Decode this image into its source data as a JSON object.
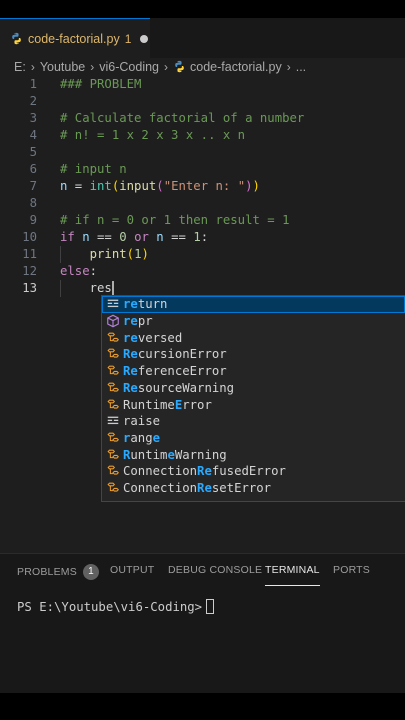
{
  "tab": {
    "filename": "code-factorial.py",
    "problem_count": "1",
    "icon": "python-icon"
  },
  "breadcrumb": {
    "drive": "E:",
    "folder1": "Youtube",
    "folder2": "vi6-Coding",
    "file": "code-factorial.py",
    "more": "..."
  },
  "editor": {
    "lines": [
      {
        "n": "1",
        "tokens": [
          {
            "t": "### PROBLEM",
            "c": "c-comment"
          }
        ]
      },
      {
        "n": "2",
        "tokens": []
      },
      {
        "n": "3",
        "tokens": [
          {
            "t": "# Calculate factorial of a number",
            "c": "c-comment"
          }
        ]
      },
      {
        "n": "4",
        "tokens": [
          {
            "t": "# n! = 1 x 2 x 3 x .. x n",
            "c": "c-comment"
          }
        ]
      },
      {
        "n": "5",
        "tokens": []
      },
      {
        "n": "6",
        "tokens": [
          {
            "t": "# input n",
            "c": "c-comment"
          }
        ]
      },
      {
        "n": "7",
        "tokens": [
          {
            "t": "n",
            "c": "c-var"
          },
          {
            "t": " = ",
            "c": "c-op"
          },
          {
            "t": "int",
            "c": "c-cls"
          },
          {
            "t": "(",
            "c": "c-paren"
          },
          {
            "t": "input",
            "c": "c-fn"
          },
          {
            "t": "(",
            "c": "c-paren2"
          },
          {
            "t": "\"Enter n: \"",
            "c": "c-str"
          },
          {
            "t": ")",
            "c": "c-paren2"
          },
          {
            "t": ")",
            "c": "c-paren"
          }
        ]
      },
      {
        "n": "8",
        "tokens": []
      },
      {
        "n": "9",
        "tokens": [
          {
            "t": "# if n = 0 or 1 then result = 1",
            "c": "c-comment"
          }
        ]
      },
      {
        "n": "10",
        "tokens": [
          {
            "t": "if",
            "c": "c-kw"
          },
          {
            "t": " ",
            "c": "c-op"
          },
          {
            "t": "n",
            "c": "c-var"
          },
          {
            "t": " == ",
            "c": "c-op"
          },
          {
            "t": "0",
            "c": "c-num"
          },
          {
            "t": " ",
            "c": "c-op"
          },
          {
            "t": "or",
            "c": "c-kw"
          },
          {
            "t": " ",
            "c": "c-op"
          },
          {
            "t": "n",
            "c": "c-var"
          },
          {
            "t": " == ",
            "c": "c-op"
          },
          {
            "t": "1",
            "c": "c-num"
          },
          {
            "t": ":",
            "c": "c-op"
          }
        ]
      },
      {
        "n": "11",
        "tokens": [
          {
            "t": "    ",
            "c": "c-op"
          },
          {
            "t": "print",
            "c": "c-fn"
          },
          {
            "t": "(",
            "c": "c-paren"
          },
          {
            "t": "1",
            "c": "c-num"
          },
          {
            "t": ")",
            "c": "c-paren"
          }
        ]
      },
      {
        "n": "12",
        "tokens": [
          {
            "t": "else",
            "c": "c-kw"
          },
          {
            "t": ":",
            "c": "c-op"
          }
        ]
      },
      {
        "n": "13",
        "tokens": [
          {
            "t": "    ",
            "c": "c-op"
          },
          {
            "t": "res",
            "c": "c-op"
          }
        ],
        "active": true,
        "cursor": true
      }
    ]
  },
  "suggestions": [
    {
      "pre": "re",
      "rest": "turn",
      "icon": "keyword-icon",
      "selected": true
    },
    {
      "pre": "re",
      "rest": "pr",
      "icon": "cube-icon"
    },
    {
      "pre": "re",
      "rest": "versed",
      "icon": "class-icon"
    },
    {
      "pre": "Re",
      "rest": "cursionError",
      "icon": "class-icon"
    },
    {
      "pre": "Re",
      "rest": "ferenceError",
      "icon": "class-icon"
    },
    {
      "pre": "Re",
      "rest": "sourceWarning",
      "icon": "class-icon"
    },
    {
      "segments": [
        {
          "t": "Runtime",
          "h": false
        },
        {
          "t": "E",
          "h": true
        },
        {
          "t": "rror",
          "h": false
        }
      ],
      "icon": "class-icon"
    },
    {
      "segments": [
        {
          "t": "raise",
          "h": false
        }
      ],
      "icon": "keyword-icon"
    },
    {
      "segments": [
        {
          "t": "r",
          "h": true
        },
        {
          "t": "ang",
          "h": false
        },
        {
          "t": "e",
          "h": true
        }
      ],
      "icon": "class-icon"
    },
    {
      "segments": [
        {
          "t": "R",
          "h": true
        },
        {
          "t": "untim",
          "h": false
        },
        {
          "t": "e",
          "h": true
        },
        {
          "t": "Warning",
          "h": false
        }
      ],
      "icon": "class-icon"
    },
    {
      "segments": [
        {
          "t": "Connection",
          "h": false
        },
        {
          "t": "Re",
          "h": true
        },
        {
          "t": "fusedError",
          "h": false
        }
      ],
      "icon": "class-icon"
    },
    {
      "segments": [
        {
          "t": "Connection",
          "h": false
        },
        {
          "t": "Re",
          "h": true
        },
        {
          "t": "setError",
          "h": false
        }
      ],
      "icon": "class-icon"
    }
  ],
  "panel": {
    "tabs": [
      "PROBLEMS",
      "OUTPUT",
      "DEBUG CONSOLE",
      "TERMINAL",
      "PORTS"
    ],
    "problems_badge": "1",
    "active_tab": "TERMINAL",
    "terminal_prompt": "PS E:\\Youtube\\vi6-Coding>"
  },
  "colors": {
    "accent": "#0078d4",
    "modified_file": "#ddb76b",
    "suggest_match": "#2aaaff",
    "suggest_selected_bg": "#04395e"
  }
}
